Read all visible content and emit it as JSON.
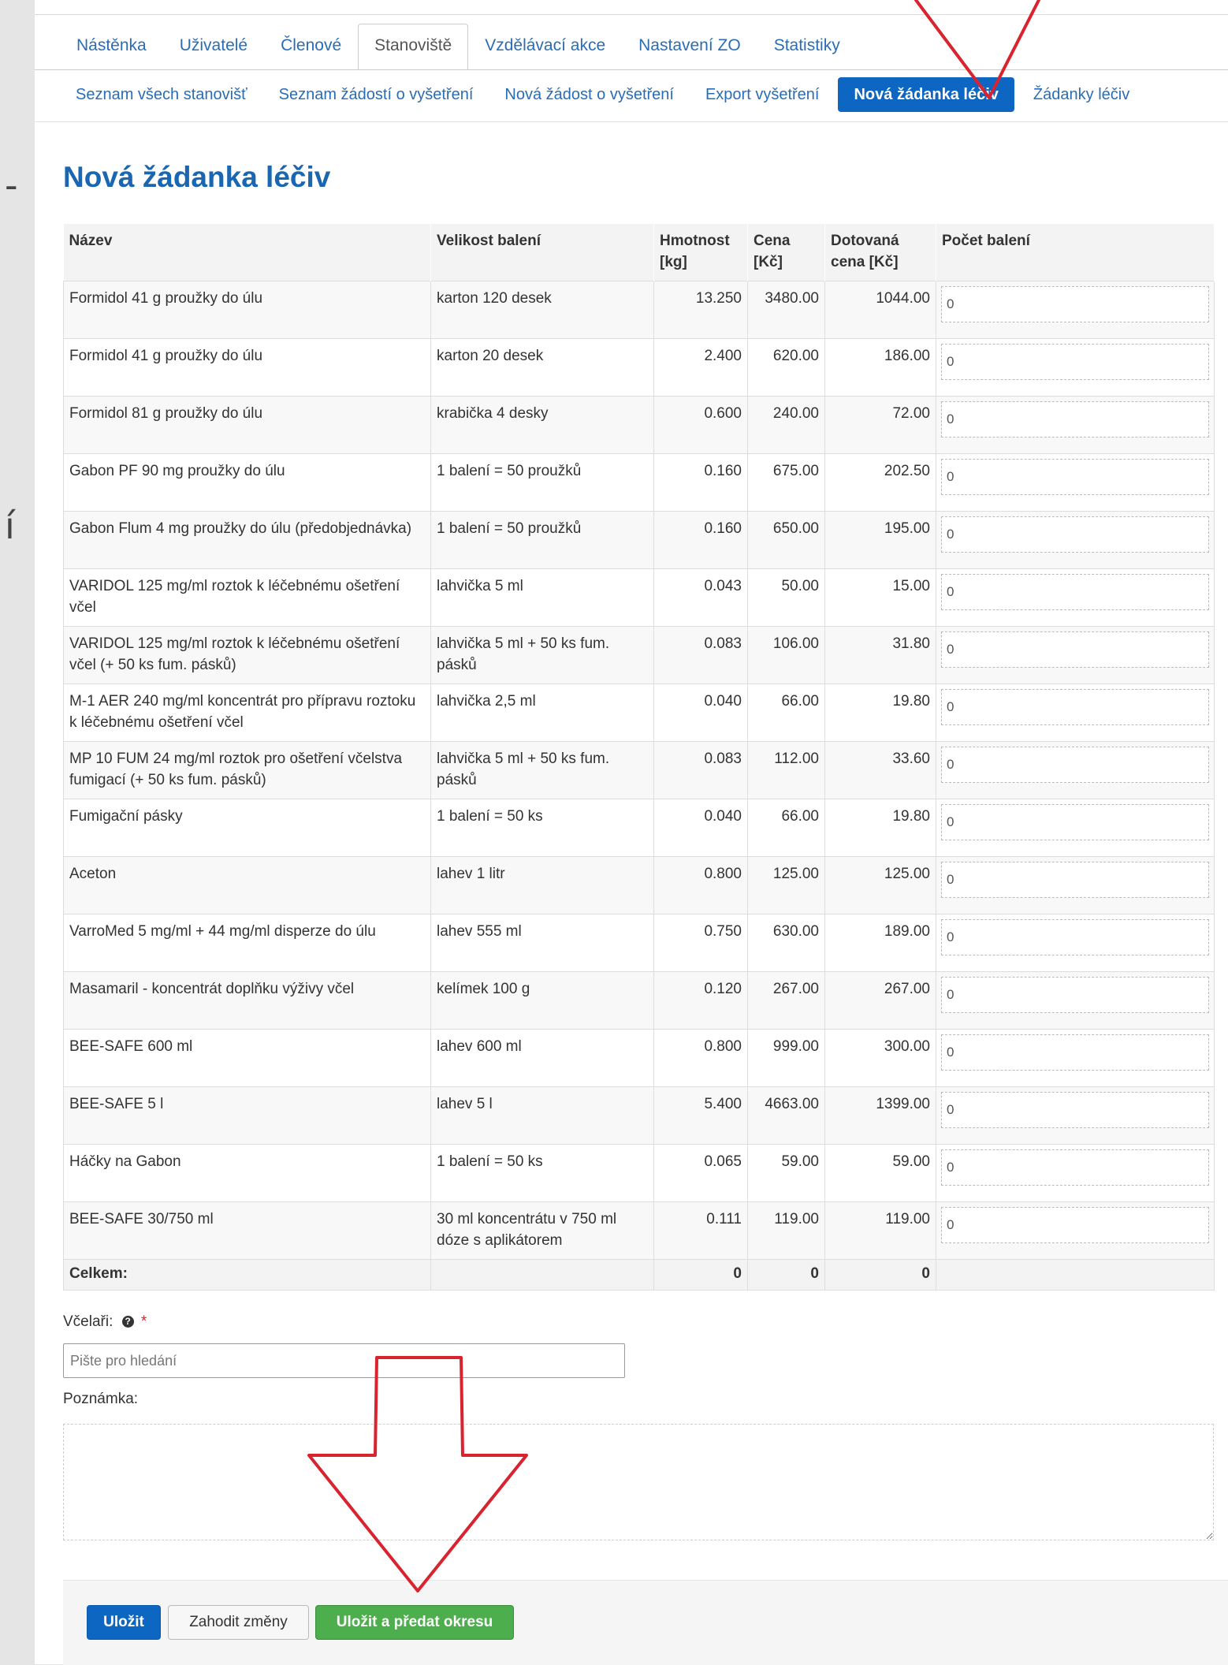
{
  "tabs": [
    {
      "label": "Nástěnka"
    },
    {
      "label": "Uživatelé"
    },
    {
      "label": "Členové"
    },
    {
      "label": "Stanoviště"
    },
    {
      "label": "Vzdělávací akce"
    },
    {
      "label": "Nastavení ZO"
    },
    {
      "label": "Statistiky"
    }
  ],
  "active_tab": "Stanoviště",
  "subnav": [
    {
      "label": "Seznam všech stanovišť"
    },
    {
      "label": "Seznam žádostí o vyšetření"
    },
    {
      "label": "Nová žádost o vyšetření"
    },
    {
      "label": "Export vyšetření"
    },
    {
      "label": "Nová žádanka léčiv"
    },
    {
      "label": "Žádanky léčiv"
    }
  ],
  "active_subnav": "Nová žádanka léčiv",
  "page_title": "Nová žádanka léčiv",
  "table": {
    "headers": {
      "name": "Název",
      "package": "Velikost balení",
      "weight": "Hmotnost [kg]",
      "price": "Cena [Kč]",
      "subsidized": "Dotovaná cena [Kč]",
      "count": "Počet balení"
    },
    "rows": [
      {
        "name": "Formidol 41 g proužky do úlu",
        "package": "karton 120 desek",
        "weight": "13.250",
        "price": "3480.00",
        "subsidized": "1044.00",
        "count": "0"
      },
      {
        "name": "Formidol 41 g proužky do úlu",
        "package": "karton 20 desek",
        "weight": "2.400",
        "price": "620.00",
        "subsidized": "186.00",
        "count": "0"
      },
      {
        "name": "Formidol 81 g proužky do úlu",
        "package": "krabička 4 desky",
        "weight": "0.600",
        "price": "240.00",
        "subsidized": "72.00",
        "count": "0"
      },
      {
        "name": "Gabon PF 90 mg proužky do úlu",
        "package": "1 balení = 50 proužků",
        "weight": "0.160",
        "price": "675.00",
        "subsidized": "202.50",
        "count": "0"
      },
      {
        "name": "Gabon Flum 4 mg proužky do úlu (předobjednávka)",
        "package": "1 balení = 50 proužků",
        "weight": "0.160",
        "price": "650.00",
        "subsidized": "195.00",
        "count": "0"
      },
      {
        "name": "VARIDOL 125 mg/ml roztok k léčebnému ošetření včel",
        "package": "lahvička 5 ml",
        "weight": "0.043",
        "price": "50.00",
        "subsidized": "15.00",
        "count": "0"
      },
      {
        "name": "VARIDOL 125 mg/ml roztok k léčebnému ošetření včel (+ 50 ks fum. pásků)",
        "package": "lahvička 5 ml + 50 ks fum. pásků",
        "weight": "0.083",
        "price": "106.00",
        "subsidized": "31.80",
        "count": "0"
      },
      {
        "name": "M-1 AER 240 mg/ml koncentrát pro přípravu roztoku k léčebnému ošetření včel",
        "package": "lahvička 2,5 ml",
        "weight": "0.040",
        "price": "66.00",
        "subsidized": "19.80",
        "count": "0"
      },
      {
        "name": "MP 10 FUM 24 mg/ml roztok pro ošetření včelstva fumigací (+ 50 ks fum. pásků)",
        "package": "lahvička 5 ml + 50 ks fum. pásků",
        "weight": "0.083",
        "price": "112.00",
        "subsidized": "33.60",
        "count": "0"
      },
      {
        "name": "Fumigační pásky",
        "package": "1 balení = 50 ks",
        "weight": "0.040",
        "price": "66.00",
        "subsidized": "19.80",
        "count": "0"
      },
      {
        "name": "Aceton",
        "package": "lahev 1 litr",
        "weight": "0.800",
        "price": "125.00",
        "subsidized": "125.00",
        "count": "0"
      },
      {
        "name": "VarroMed 5 mg/ml + 44 mg/ml disperze do úlu",
        "package": "lahev 555 ml",
        "weight": "0.750",
        "price": "630.00",
        "subsidized": "189.00",
        "count": "0"
      },
      {
        "name": "Masamaril - koncentrát doplňku výživy včel",
        "package": "kelímek 100 g",
        "weight": "0.120",
        "price": "267.00",
        "subsidized": "267.00",
        "count": "0"
      },
      {
        "name": "BEE-SAFE 600 ml",
        "package": "lahev 600 ml",
        "weight": "0.800",
        "price": "999.00",
        "subsidized": "300.00",
        "count": "0"
      },
      {
        "name": "BEE-SAFE 5 l",
        "package": "lahev 5 l",
        "weight": "5.400",
        "price": "4663.00",
        "subsidized": "1399.00",
        "count": "0"
      },
      {
        "name": "Háčky na Gabon",
        "package": "1 balení = 50 ks",
        "weight": "0.065",
        "price": "59.00",
        "subsidized": "59.00",
        "count": "0"
      },
      {
        "name": "BEE-SAFE 30/750 ml",
        "package": "30 ml koncentrátu v 750 ml dóze s aplikátorem",
        "weight": "0.111",
        "price": "119.00",
        "subsidized": "119.00",
        "count": "0"
      }
    ],
    "footer": {
      "label": "Celkem:",
      "weight": "0",
      "price": "0",
      "subsidized": "0"
    }
  },
  "beekeepers": {
    "label": "Včelaři:",
    "required_mark": "*",
    "placeholder": "Pište pro hledání",
    "help_icon": "question-circle-icon"
  },
  "note": {
    "label": "Poznámka:",
    "value": ""
  },
  "buttons": {
    "save": "Uložit",
    "discard": "Zahodit změny",
    "submit": "Uložit a předat okresu"
  },
  "colors": {
    "primary": "#0d67c2",
    "success": "#4cae4c",
    "title": "#1a66b0",
    "link": "#2a6db5",
    "annotation": "#d9232e"
  }
}
